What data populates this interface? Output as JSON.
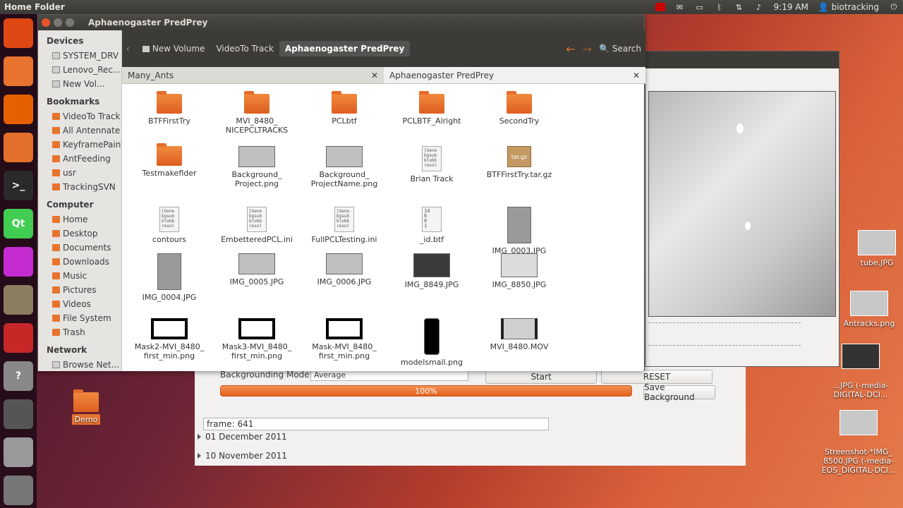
{
  "topbar": {
    "title": "Home Folder",
    "time": "9:19 AM",
    "user": "biotracking"
  },
  "launcher": [
    {
      "name": "dash",
      "label": "",
      "color": "#dd4814"
    },
    {
      "name": "files",
      "label": "",
      "color": "#e8732e"
    },
    {
      "name": "firefox",
      "label": "",
      "color": "#e66000"
    },
    {
      "name": "software-center",
      "label": "",
      "color": "#e26f2b"
    },
    {
      "name": "terminal",
      "label": ">_",
      "color": "#2a2a2a"
    },
    {
      "name": "qt-creator",
      "label": "Qt",
      "color": "#41cd52"
    },
    {
      "name": "video-editor",
      "label": "",
      "color": "#c42bd1"
    },
    {
      "name": "gimp",
      "label": "",
      "color": "#8b7d5f"
    },
    {
      "name": "bug-reporter",
      "label": "",
      "color": "#c62828"
    },
    {
      "name": "help",
      "label": "?",
      "color": "#888"
    },
    {
      "name": "workspaces",
      "label": "",
      "color": "#555"
    },
    {
      "name": "drive",
      "label": "",
      "color": "#999"
    },
    {
      "name": "trash",
      "label": "",
      "color": "#777"
    }
  ],
  "window": {
    "title": "Aphaenogaster PredPrey"
  },
  "breadcrumbs": [
    "New Volume",
    "VideoTo Track",
    "Aphaenogaster PredPrey"
  ],
  "search_label": "Search",
  "sidebar": {
    "devices_header": "Devices",
    "devices": [
      "SYSTEM_DRV",
      "Lenovo_Rec...",
      "New Vol..."
    ],
    "bookmarks_header": "Bookmarks",
    "bookmarks": [
      "VideoTo Track",
      "All Antennate",
      "KeyframePaint",
      "AntFeeding",
      "usr",
      "TrackingSVN"
    ],
    "computer_header": "Computer",
    "computer": [
      "Home",
      "Desktop",
      "Documents",
      "Downloads",
      "Music",
      "Pictures",
      "Videos",
      "File System",
      "Trash"
    ],
    "network_header": "Network",
    "network": [
      "Browse Net..."
    ]
  },
  "tabs": [
    "Many_Ants",
    "Aphaenogaster PredPrey"
  ],
  "files": [
    {
      "name": "BTFFirstTry",
      "type": "folder"
    },
    {
      "name": "MVI_8480_\nNICEPCLTRACKS",
      "type": "folder"
    },
    {
      "name": "PCLbtf",
      "type": "folder"
    },
    {
      "name": "PCLBTF_Alright",
      "type": "folder"
    },
    {
      "name": "SecondTry",
      "type": "folder"
    },
    {
      "name": "Testmakeflder",
      "type": "folder"
    },
    {
      "name": "Background_\nProject.png",
      "type": "image"
    },
    {
      "name": "Background_\nProjectName.png",
      "type": "image"
    },
    {
      "name": "Brian Track",
      "type": "text"
    },
    {
      "name": "BTFFirstTry.tar.gz",
      "type": "archive"
    },
    {
      "name": "contours",
      "type": "text"
    },
    {
      "name": "EmbetteredPCL.ini",
      "type": "text"
    },
    {
      "name": "FullPCLTesting.ini",
      "type": "text"
    },
    {
      "name": "_id.btf",
      "type": "num"
    },
    {
      "name": "IMG_0003.JPG",
      "type": "tall"
    },
    {
      "name": "IMG_0004.JPG",
      "type": "tall"
    },
    {
      "name": "IMG_0005.JPG",
      "type": "image"
    },
    {
      "name": "IMG_0006.JPG",
      "type": "image"
    },
    {
      "name": "IMG_8849.JPG",
      "type": "dark"
    },
    {
      "name": "IMG_8850.JPG",
      "type": "light"
    },
    {
      "name": "Mask2-MVI_8480_\nfirst_min.png",
      "type": "mask"
    },
    {
      "name": "Mask3-MVI_8480_\nfirst_min.png",
      "type": "mask"
    },
    {
      "name": "Mask-MVI_8480_\nfirst_min.png",
      "type": "mask"
    },
    {
      "name": "modelsmall.png",
      "type": "model"
    },
    {
      "name": "MVI_8480.MOV",
      "type": "video"
    }
  ],
  "text_preview": "[Gene\nbgsub\nblobb\nresol",
  "num_preview": "14\n6\n0\n1",
  "archive_label": "tar.gz",
  "lower": {
    "bg_mode_label": "Backgrounding Mode",
    "bg_mode_value": "Average",
    "start": "Start",
    "reset": "RESET",
    "progress": 100,
    "progress_text": "100%",
    "save": "Save Background",
    "frame_text": "frame: 641",
    "dates": [
      "01 December 2011",
      "10 November 2011"
    ]
  },
  "desktop_icons": [
    {
      "name": "Demo"
    },
    {
      "name": "tube.JPG"
    },
    {
      "name": "Antracks.png"
    },
    {
      "name": "...JPG (-media-\nDIGITAL-DCI..."
    },
    {
      "name": "Streenshot-*IMG_\n8500.JPG (-media-\nEOS_DIGITAL-DCI..."
    }
  ]
}
